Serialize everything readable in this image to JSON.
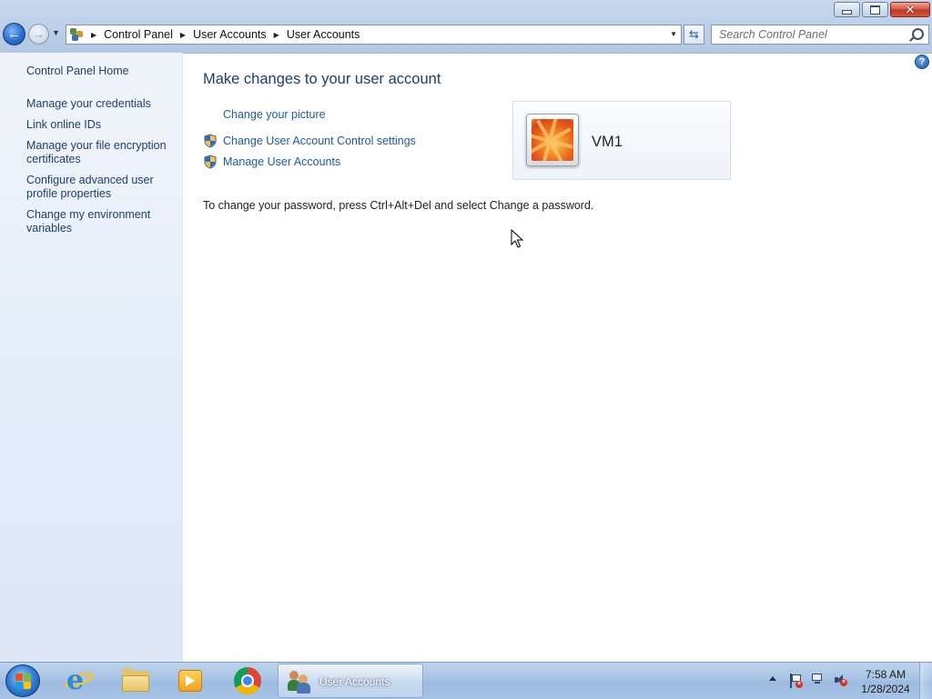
{
  "window": {
    "controls": {
      "minimize": "minimize",
      "maximize": "restore",
      "close": "close"
    }
  },
  "toolbar": {
    "breadcrumbs": [
      "Control Panel",
      "User Accounts",
      "User Accounts"
    ],
    "search_placeholder": "Search Control Panel"
  },
  "sidebar": {
    "home_label": "Control Panel Home",
    "items": [
      {
        "label": "Manage your credentials"
      },
      {
        "label": "Link online IDs"
      },
      {
        "label": "Manage your file encryption certificates"
      },
      {
        "label": "Configure advanced user profile properties"
      },
      {
        "label": "Change my environment variables"
      }
    ]
  },
  "main": {
    "title": "Make changes to your user account",
    "tasks": [
      {
        "label": "Change your picture",
        "icon": "none"
      },
      {
        "label": "Change User Account Control settings",
        "icon": "uac-shield-icon"
      },
      {
        "label": "Manage User Accounts",
        "icon": "uac-shield-icon"
      }
    ],
    "account": {
      "name": "VM1"
    },
    "password_note": "To change your password, press Ctrl+Alt+Del and select Change a password."
  },
  "taskbar": {
    "pinned": [
      "internet-explorer-icon",
      "windows-explorer-icon",
      "media-player-icon",
      "chrome-icon"
    ],
    "active_window_label": "User Accounts",
    "clock": {
      "time": "7:58 AM",
      "date": "1/28/2024"
    }
  },
  "colors": {
    "link": "#1e5aa8",
    "title": "#1e3d6d",
    "sidebar_link": "#1e3f6b"
  }
}
